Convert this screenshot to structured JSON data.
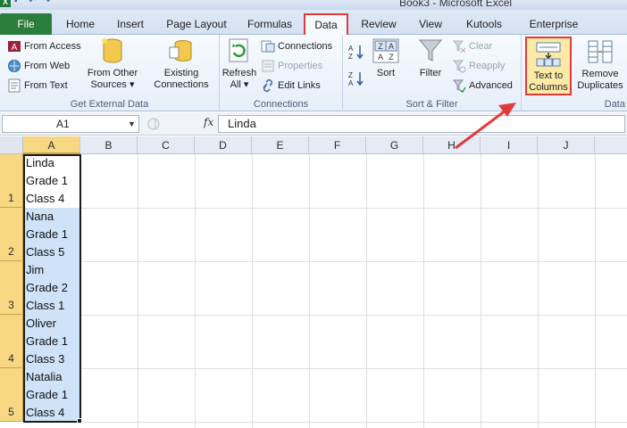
{
  "window": {
    "title": "Book3 - Microsoft Excel"
  },
  "tabs": [
    {
      "label": "File"
    },
    {
      "label": "Home"
    },
    {
      "label": "Insert"
    },
    {
      "label": "Page Layout"
    },
    {
      "label": "Formulas"
    },
    {
      "label": "Data"
    },
    {
      "label": "Review"
    },
    {
      "label": "View"
    },
    {
      "label": "Kutools"
    },
    {
      "label": "Enterprise"
    }
  ],
  "ribbon": {
    "get_external_data": {
      "label": "Get External Data",
      "from_access": "From Access",
      "from_web": "From Web",
      "from_text": "From Text",
      "from_other_sources_line1": "From Other",
      "from_other_sources_line2": "Sources ▾",
      "existing_connections_line1": "Existing",
      "existing_connections_line2": "Connections"
    },
    "connections": {
      "label": "Connections",
      "refresh_all_line1": "Refresh",
      "refresh_all_line2": "All ▾",
      "connections": "Connections",
      "properties": "Properties",
      "edit_links": "Edit Links"
    },
    "sort_filter": {
      "label": "Sort & Filter",
      "sort": "Sort",
      "filter": "Filter",
      "clear": "Clear",
      "reapply": "Reapply",
      "advanced": "Advanced"
    },
    "data_tools": {
      "label": "Data",
      "text_to_columns_line1": "Text to",
      "text_to_columns_line2": "Columns",
      "remove_duplicates_line1": "Remove",
      "remove_duplicates_line2": "Duplicates"
    }
  },
  "formula_bar": {
    "name_box": "A1",
    "fx": "fx",
    "value": "Linda"
  },
  "sheet": {
    "columns": [
      "A",
      "B",
      "C",
      "D",
      "E",
      "F",
      "G",
      "H",
      "I",
      "J"
    ],
    "rows": [
      {
        "number": "1",
        "lines": [
          "Linda",
          "Grade 1",
          "Class 4"
        ]
      },
      {
        "number": "2",
        "lines": [
          "Nana",
          "Grade 1",
          "Class 5"
        ]
      },
      {
        "number": "3",
        "lines": [
          "Jim",
          "Grade 2",
          "Class 1"
        ]
      },
      {
        "number": "4",
        "lines": [
          "Oliver",
          "Grade 1",
          "Class 3"
        ]
      },
      {
        "number": "5",
        "lines": [
          "Natalia",
          "Grade 1",
          "Class 4"
        ]
      }
    ]
  },
  "colors": {
    "file_tab": "#2a7d3b",
    "highlight_outline": "#e23a3a",
    "selection_fill": "#cfe2f7",
    "header_selected": "#f8d783"
  }
}
